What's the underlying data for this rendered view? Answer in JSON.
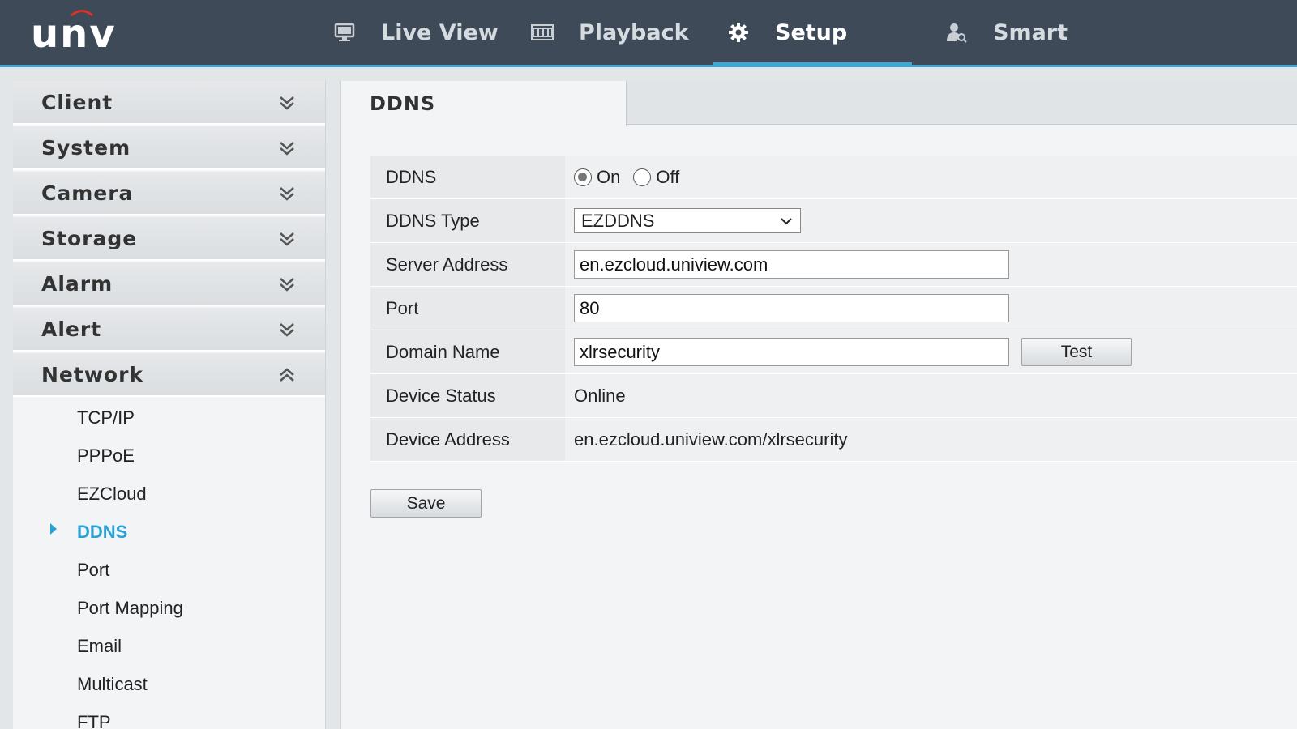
{
  "header": {
    "logo": "UNV",
    "nav": [
      {
        "label": "Live View",
        "icon": "monitor-icon"
      },
      {
        "label": "Playback",
        "icon": "film-icon"
      },
      {
        "label": "Setup",
        "icon": "gear-icon",
        "active": true
      },
      {
        "label": "Smart",
        "icon": "smart-person-icon"
      }
    ],
    "accent_color": "#3ea8d6"
  },
  "sidebar": {
    "sections": [
      {
        "label": "Client",
        "expanded": false
      },
      {
        "label": "System",
        "expanded": false
      },
      {
        "label": "Camera",
        "expanded": false
      },
      {
        "label": "Storage",
        "expanded": false
      },
      {
        "label": "Alarm",
        "expanded": false
      },
      {
        "label": "Alert",
        "expanded": false
      },
      {
        "label": "Network",
        "expanded": true
      }
    ],
    "network_items": [
      "TCP/IP",
      "PPPoE",
      "EZCloud",
      "DDNS",
      "Port",
      "Port Mapping",
      "Email",
      "Multicast",
      "FTP"
    ],
    "active_item": "DDNS"
  },
  "main": {
    "tab": "DDNS",
    "form": {
      "ddns_label": "DDNS",
      "ddns_on": "On",
      "ddns_off": "Off",
      "ddns_value": "On",
      "type_label": "DDNS Type",
      "type_value": "EZDDNS",
      "server_label": "Server Address",
      "server_value": "en.ezcloud.uniview.com",
      "port_label": "Port",
      "port_value": "80",
      "domain_label": "Domain Name",
      "domain_value": "xlrsecurity",
      "test_label": "Test",
      "status_label": "Device Status",
      "status_value": "Online",
      "address_label": "Device Address",
      "address_value": "en.ezcloud.uniview.com/xlrsecurity"
    },
    "save_label": "Save"
  }
}
